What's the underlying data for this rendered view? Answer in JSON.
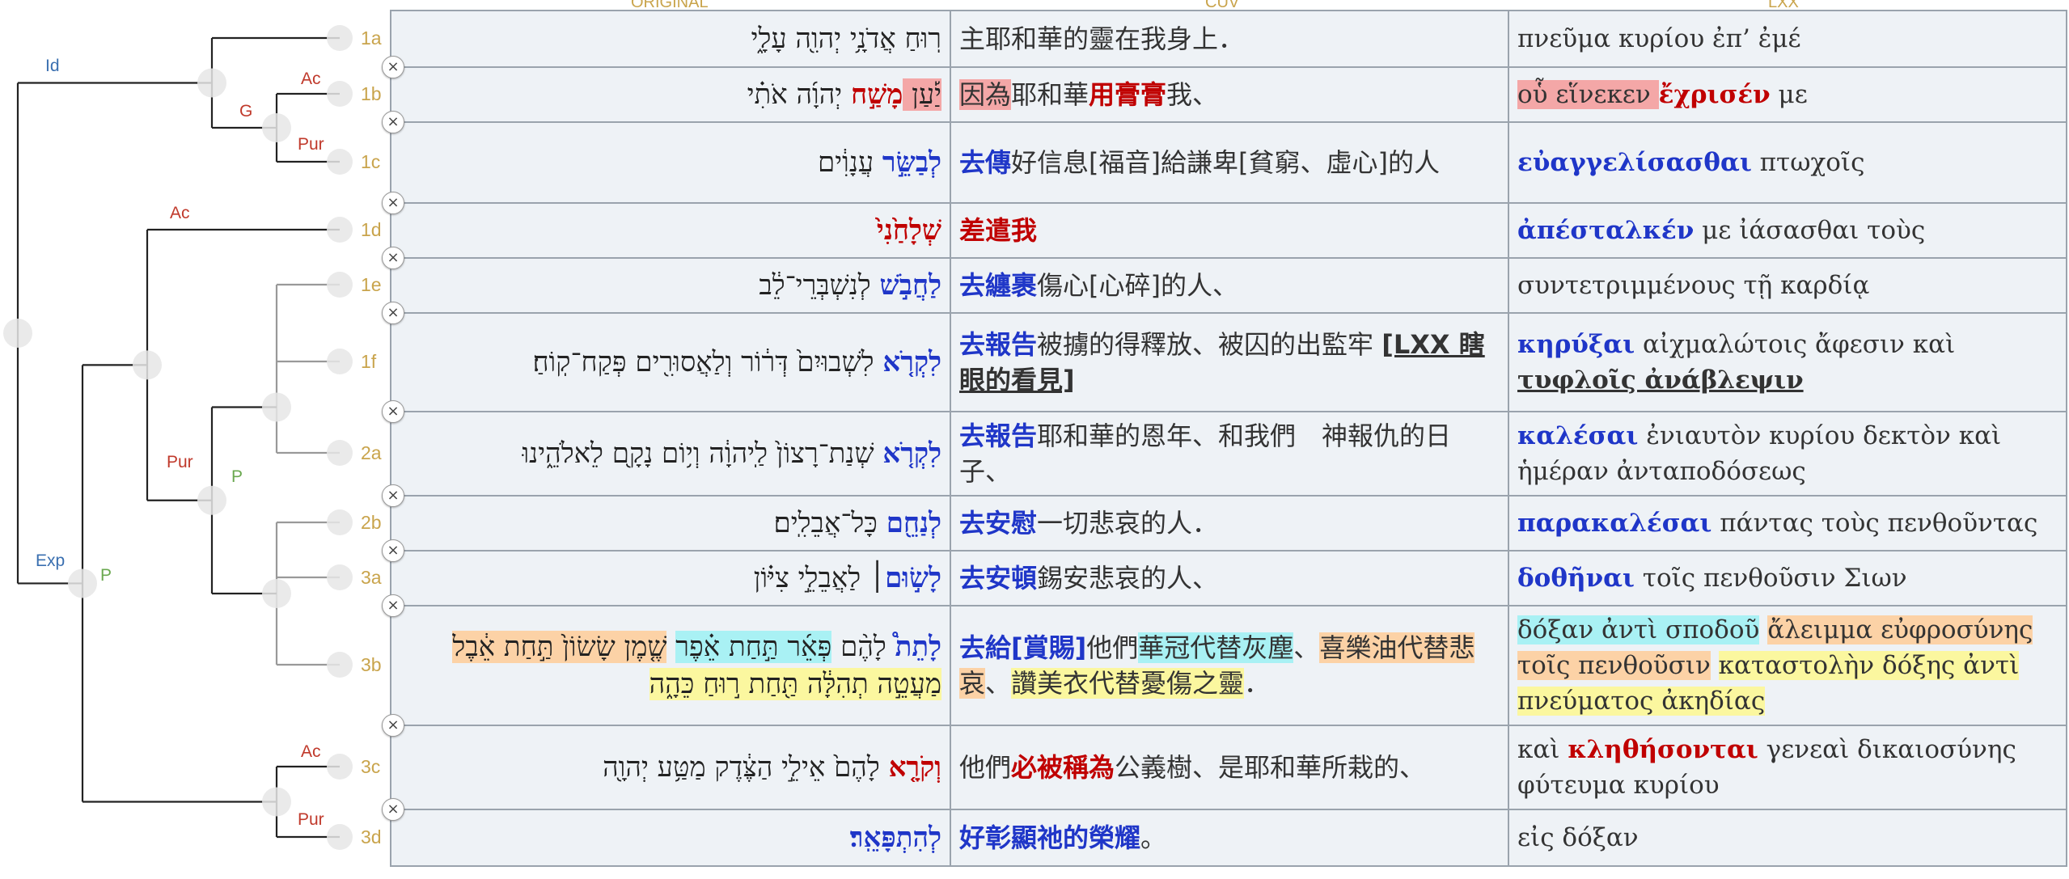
{
  "headers": {
    "original": "ORIGINAL",
    "cuv": "CUV",
    "lxx": "LXX"
  },
  "tree": {
    "labels": {
      "id": "Id",
      "exp": "Exp",
      "g": "G",
      "ac1": "Ac",
      "pur1": "Pur",
      "ac2": "Ac",
      "pur2": "Pur",
      "p1": "P",
      "p2": "P",
      "ac3": "Ac",
      "pur3": "Pur"
    },
    "colors": {
      "blue": "#3a6fb0",
      "red": "#c0392b",
      "green": "#6aa84f",
      "gold": "#c9a44c"
    }
  },
  "remove_icon": "×",
  "rows": [
    {
      "id": "1a",
      "heb": [
        {
          "t": "רֽוּחַ אֲדֹנָ֥י יְהוִ֖ה עָלָ֑י"
        }
      ],
      "cuv": [
        {
          "t": "主耶和華的靈在我身上．"
        }
      ],
      "lxx": [
        {
          "t": "πνεῦμα κυρίου ἐπ’ ἐμέ"
        }
      ]
    },
    {
      "id": "1b",
      "heb": [
        {
          "t": "יַ֡עַן ",
          "s": "hl-r"
        },
        {
          "t": "מָשַׁ֣ח",
          "s": "vr"
        },
        {
          "t": " יְהוָ֜ה אֹתִ֗י"
        }
      ],
      "cuv": [
        {
          "t": "因為",
          "s": "hl-r"
        },
        {
          "t": "耶和華"
        },
        {
          "t": "用膏膏",
          "s": "vr"
        },
        {
          "t": "我、"
        }
      ],
      "lxx": [
        {
          "t": "οὗ εἵνεκεν ",
          "s": "hl-r"
        },
        {
          "t": "ἔχρισέν",
          "s": "vr"
        },
        {
          "t": " με"
        }
      ]
    },
    {
      "id": "1c",
      "heb": [
        {
          "t": "לְבַשֵּׂ֣ר",
          "s": "vb"
        },
        {
          "t": " עֲנָוִ֔ים"
        }
      ],
      "cuv": [
        {
          "t": "去傳",
          "s": "vb"
        },
        {
          "t": "好信息[福音]給謙卑[貧窮、虛心]的人"
        }
      ],
      "lxx": [
        {
          "t": "εὐαγγελίσασθαι",
          "s": "vb"
        },
        {
          "t": " πτωχοῖς"
        }
      ]
    },
    {
      "id": "1d",
      "heb": [
        {
          "t": "שְׁלָחַ֙נִי֙",
          "s": "vr"
        }
      ],
      "cuv": [
        {
          "t": "差遣我",
          "s": "vr"
        }
      ],
      "lxx": [
        {
          "t": "ἀπέσταλκέν",
          "s": "vb"
        },
        {
          "t": " με ἰάσασθαι τοὺς"
        }
      ]
    },
    {
      "id": "1e",
      "heb": [
        {
          "t": "לַחֲבֹ֣שׁ",
          "s": "vb"
        },
        {
          "t": " לְנִשְׁבְּרֵי־לֵ֔ב"
        }
      ],
      "cuv": [
        {
          "t": "去纏裹",
          "s": "vb"
        },
        {
          "t": "傷心[心碎]的人、"
        }
      ],
      "lxx": [
        {
          "t": "συντετριμμένους τῇ καρδίᾳ"
        }
      ]
    },
    {
      "id": "1f",
      "heb": [
        {
          "t": "לִקְרֹ֤א",
          "s": "vb"
        },
        {
          "t": " לִשְׁבוּיִם֙ דְּר֔וֹר וְלַאֲסוּרִ֖ים פְּקַח־קֽוֹחַ׃"
        }
      ],
      "cuv": [
        {
          "t": "去報告",
          "s": "vb"
        },
        {
          "t": "被擄的得釋放、被囚的出監牢 "
        },
        {
          "t": "[LXX 瞎眼的看見]",
          "s": "u"
        }
      ],
      "lxx": [
        {
          "t": "κηρύξαι",
          "s": "vb"
        },
        {
          "t": " αἰχμαλώτοις ἄφεσιν καὶ "
        },
        {
          "t": "τυφλοῖς ἀνάβλεψιν",
          "s": "u"
        }
      ]
    },
    {
      "id": "2a",
      "heb": [
        {
          "t": "לִקְרֹ֤א",
          "s": "vb"
        },
        {
          "t": " שְׁנַת־רָצוֹן֙ לַֽיהוָ֔ה וְי֥וֹם נָקָ֖ם לֵאלֹהֵ֑ינוּ"
        }
      ],
      "cuv": [
        {
          "t": "去報告",
          "s": "vb"
        },
        {
          "t": "耶和華的恩年、和我們　神報仇的日子、"
        }
      ],
      "lxx": [
        {
          "t": "καλέσαι",
          "s": "vb"
        },
        {
          "t": " ἐνιαυτὸν κυρίου δεκτὸν καὶ ἡμέραν ἀνταποδόσεως"
        }
      ]
    },
    {
      "id": "2b",
      "heb": [
        {
          "t": "לְנַחֵ֖ם",
          "s": "vb"
        },
        {
          "t": " כָּל־אֲבֵלִֽים׃"
        }
      ],
      "cuv": [
        {
          "t": "去安慰",
          "s": "vb"
        },
        {
          "t": "一切悲哀的人．"
        }
      ],
      "lxx": [
        {
          "t": "παρακαλέσαι",
          "s": "vb"
        },
        {
          "t": " πάντας τοὺς πενθοῦντας"
        }
      ]
    },
    {
      "id": "3a",
      "heb": [
        {
          "t": "לָשׂ֣וּם",
          "s": "vb"
        },
        {
          "t": "׀ לַאֲבֵלֵ֣י צִיּ֗וֹן"
        }
      ],
      "cuv": [
        {
          "t": "去安頓",
          "s": "vb"
        },
        {
          "t": "錫安悲哀的人、"
        }
      ],
      "lxx": [
        {
          "t": "δοθῆναι",
          "s": "vb"
        },
        {
          "t": " τοῖς πενθοῦσιν Σιων"
        }
      ]
    },
    {
      "id": "3b",
      "heb": [
        {
          "t": "לָתֵת֩",
          "s": "vb"
        },
        {
          "t": " לָהֶ֨ם "
        },
        {
          "t": "פְּאֵ֜ר תַּ֣חַת אֵ֗פֶר",
          "s": "hl-c"
        },
        {
          "t": " "
        },
        {
          "t": "שֶׁ֤מֶן שָׂשׂוֹן֙ תַּ֣חַת אֵ֔בֶל",
          "s": "hl-o"
        },
        {
          "t": " "
        },
        {
          "t": "מַעֲטֵ֣ה תְהִלָּ֔ה תַּ֖חַת ר֣וּחַ כֵּהָ֑ה",
          "s": "hl-y"
        }
      ],
      "cuv": [
        {
          "t": "去給[賞賜]",
          "s": "vb"
        },
        {
          "t": "他們"
        },
        {
          "t": "華冠代替灰塵",
          "s": "hl-c"
        },
        {
          "t": "、"
        },
        {
          "t": "喜樂油代替悲哀",
          "s": "hl-o"
        },
        {
          "t": "、"
        },
        {
          "t": "讚美衣代替憂傷之靈",
          "s": "hl-y"
        },
        {
          "t": "．"
        }
      ],
      "lxx": [
        {
          "t": "δόξαν ἀντὶ σποδοῦ",
          "s": "hl-c"
        },
        {
          "t": " "
        },
        {
          "t": "ἄλειμμα εὐφροσύνης τοῖς πενθοῦσιν",
          "s": "hl-o"
        },
        {
          "t": " "
        },
        {
          "t": "καταστολὴν δόξης ἀντὶ πνεύματος ἀκηδίας",
          "s": "hl-y"
        }
      ]
    },
    {
      "id": "3c",
      "heb": [
        {
          "t": "וְקֹרָ֤א",
          "s": "vr"
        },
        {
          "t": " לָהֶם֙ אֵילֵ֣י הַצֶּ֔דֶק מַטַּ֥ע יְהוָ֖ה"
        }
      ],
      "cuv": [
        {
          "t": "他們"
        },
        {
          "t": "必被稱為",
          "s": "vr"
        },
        {
          "t": "公義樹、是耶和華所栽的、"
        }
      ],
      "lxx": [
        {
          "t": "καὶ "
        },
        {
          "t": "κληθήσονται",
          "s": "vr"
        },
        {
          "t": " γενεαὶ δικαιοσύνης φύτευμα κυρίου"
        }
      ]
    },
    {
      "id": "3d",
      "heb": [
        {
          "t": "לְהִתְפָּאֵֽר׃",
          "s": "vb"
        }
      ],
      "cuv": [
        {
          "t": "好彰顯祂的榮耀",
          "s": "vb"
        },
        {
          "t": "。"
        }
      ],
      "lxx": [
        {
          "t": "εἰς δόξαν"
        }
      ]
    }
  ]
}
